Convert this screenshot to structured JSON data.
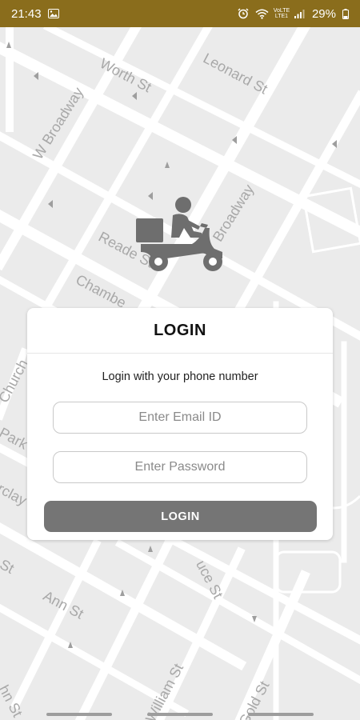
{
  "status_bar": {
    "time": "21:43",
    "battery": "29%",
    "network": "VoLTE LTE1",
    "background_color": "#8a6d1c"
  },
  "map": {
    "street_labels": [
      "Worth St",
      "Leonard St",
      "W Broadway",
      "Broadway",
      "Reade St",
      "Chambe",
      "Church",
      "Park",
      "rclay",
      "St",
      "Ann St",
      "uce St",
      "William St",
      "Gold St",
      "hn St"
    ]
  },
  "login_card": {
    "title": "LOGIN",
    "subtitle": "Login with your phone number",
    "email_placeholder": "Enter Email ID",
    "password_placeholder": "Enter Password",
    "button_label": "LOGIN"
  },
  "colors": {
    "button_bg": "#757575",
    "map_bg": "#ebebeb",
    "street_color": "#ffffff"
  },
  "icons": {
    "logo": "delivery-scooter-icon",
    "status_image": "image-icon",
    "alarm": "alarm-icon",
    "wifi": "wifi-icon",
    "signal": "signal-icon",
    "battery": "battery-icon"
  }
}
